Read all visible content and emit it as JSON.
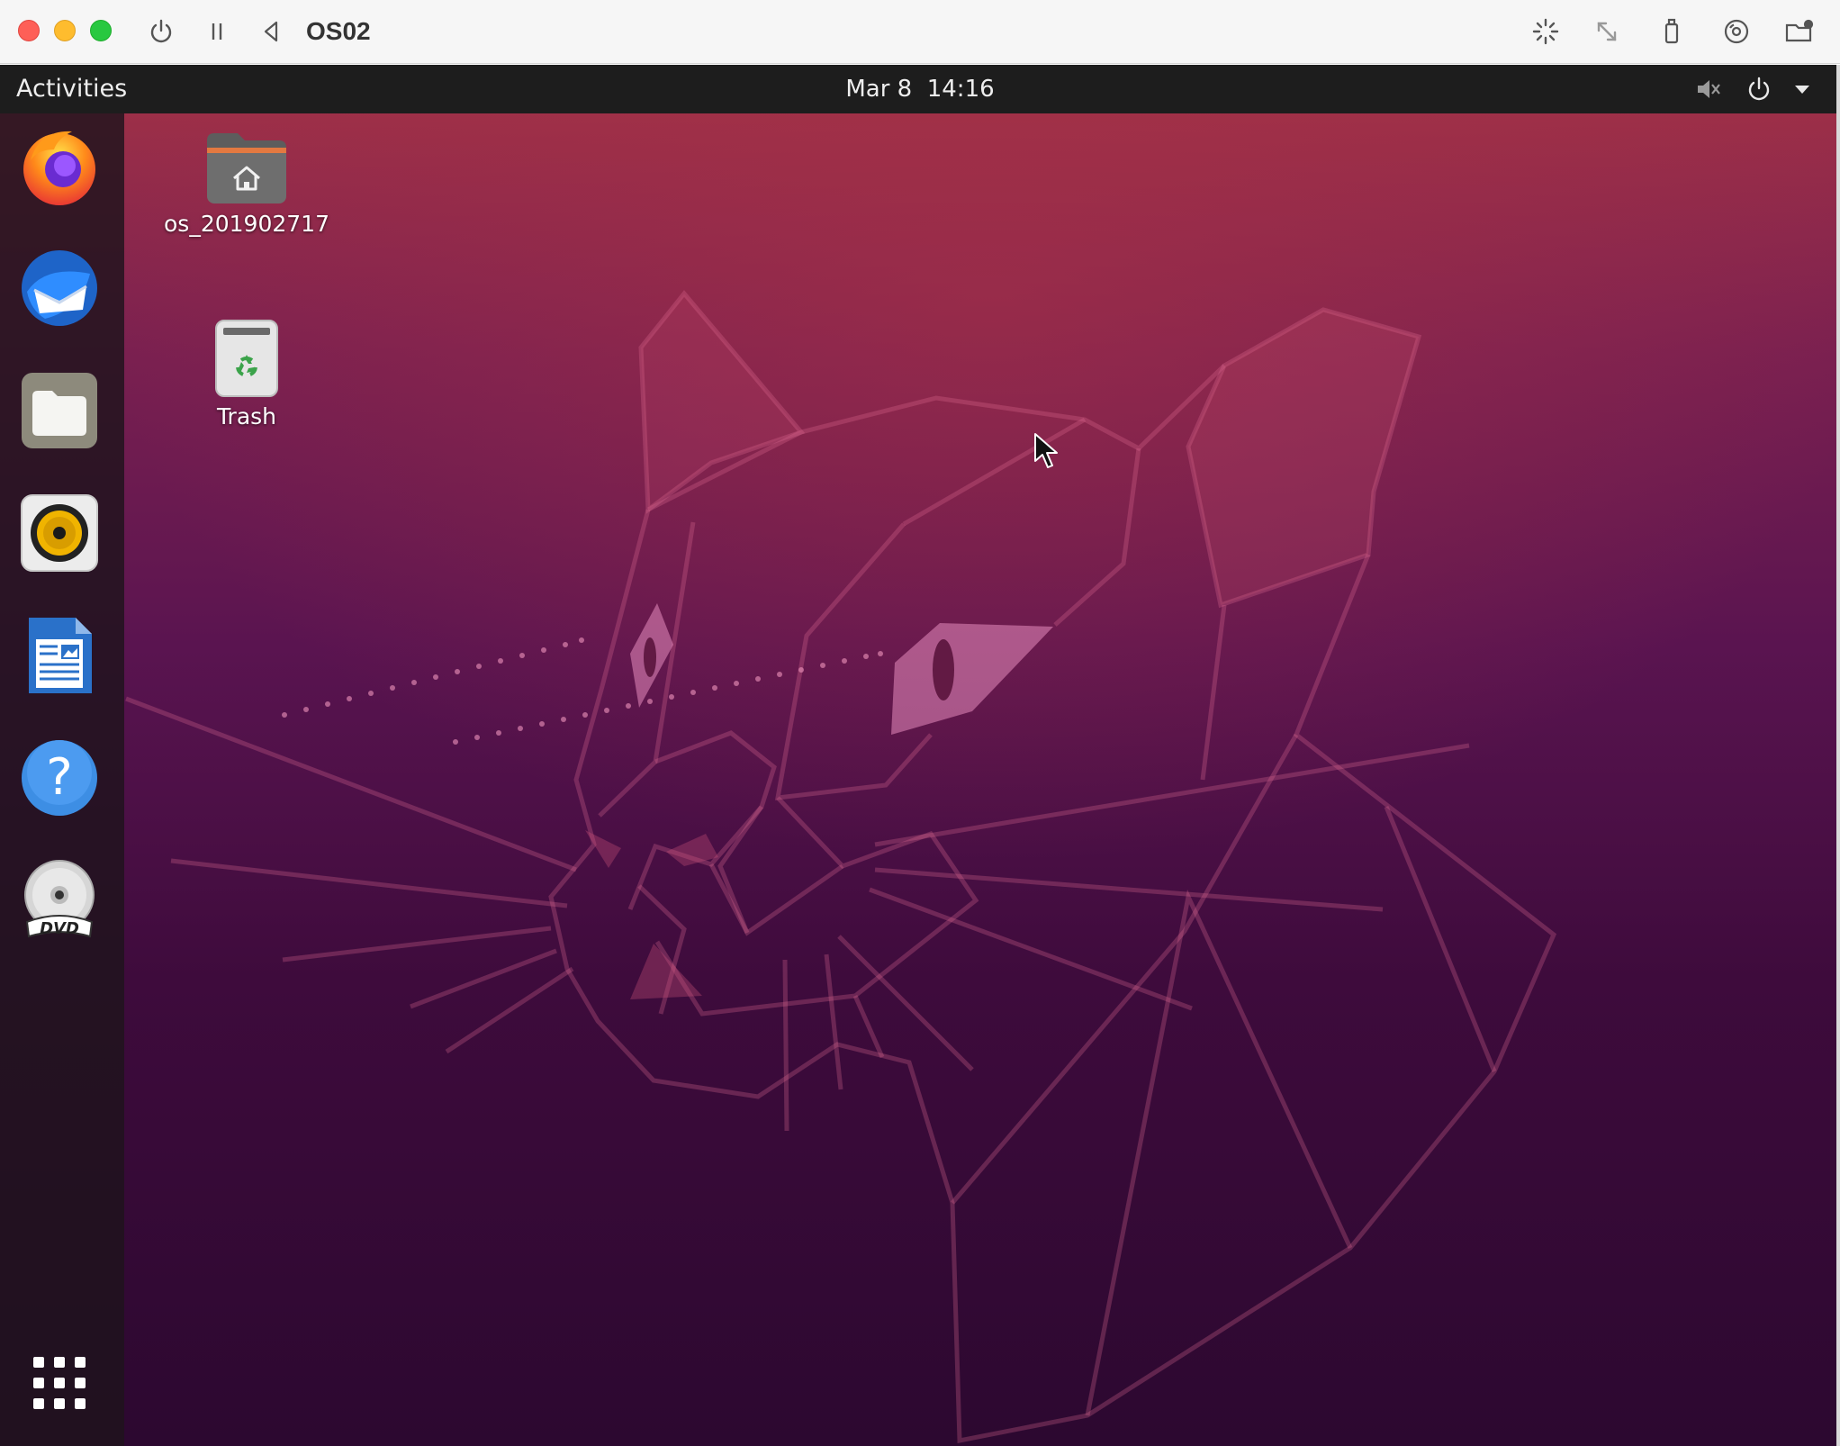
{
  "vm_window": {
    "title": "OS02",
    "toolbar_icons": [
      "power-icon",
      "pause-icon",
      "back-icon",
      "loading-icon",
      "resize-icon",
      "usb-icon",
      "disc-icon",
      "shared-folder-icon"
    ]
  },
  "topbar": {
    "activities_label": "Activities",
    "clock": "Mar 8  14:16",
    "tray_icons": [
      "volume-muted-icon",
      "power-icon",
      "dropdown-arrow-icon"
    ]
  },
  "dock": {
    "items": [
      {
        "name": "firefox",
        "icon": "firefox-icon"
      },
      {
        "name": "thunderbird",
        "icon": "thunderbird-icon"
      },
      {
        "name": "files",
        "icon": "files-icon"
      },
      {
        "name": "rhythmbox",
        "icon": "rhythmbox-icon"
      },
      {
        "name": "libreoffice-writer",
        "icon": "writer-icon"
      },
      {
        "name": "help",
        "icon": "help-icon"
      },
      {
        "name": "dvd",
        "icon": "dvd-icon"
      }
    ],
    "show_apps_icon": "app-grid-icon"
  },
  "desktop": {
    "icons": [
      {
        "label": "os_201902717",
        "icon": "home-folder-icon"
      },
      {
        "label": "Trash",
        "icon": "trash-icon"
      }
    ]
  },
  "colors": {
    "accent": "#e95420",
    "topbar": "#1d1d1d",
    "wallpaper_top": "#9c2f48",
    "wallpaper_bottom": "#2c0830"
  }
}
